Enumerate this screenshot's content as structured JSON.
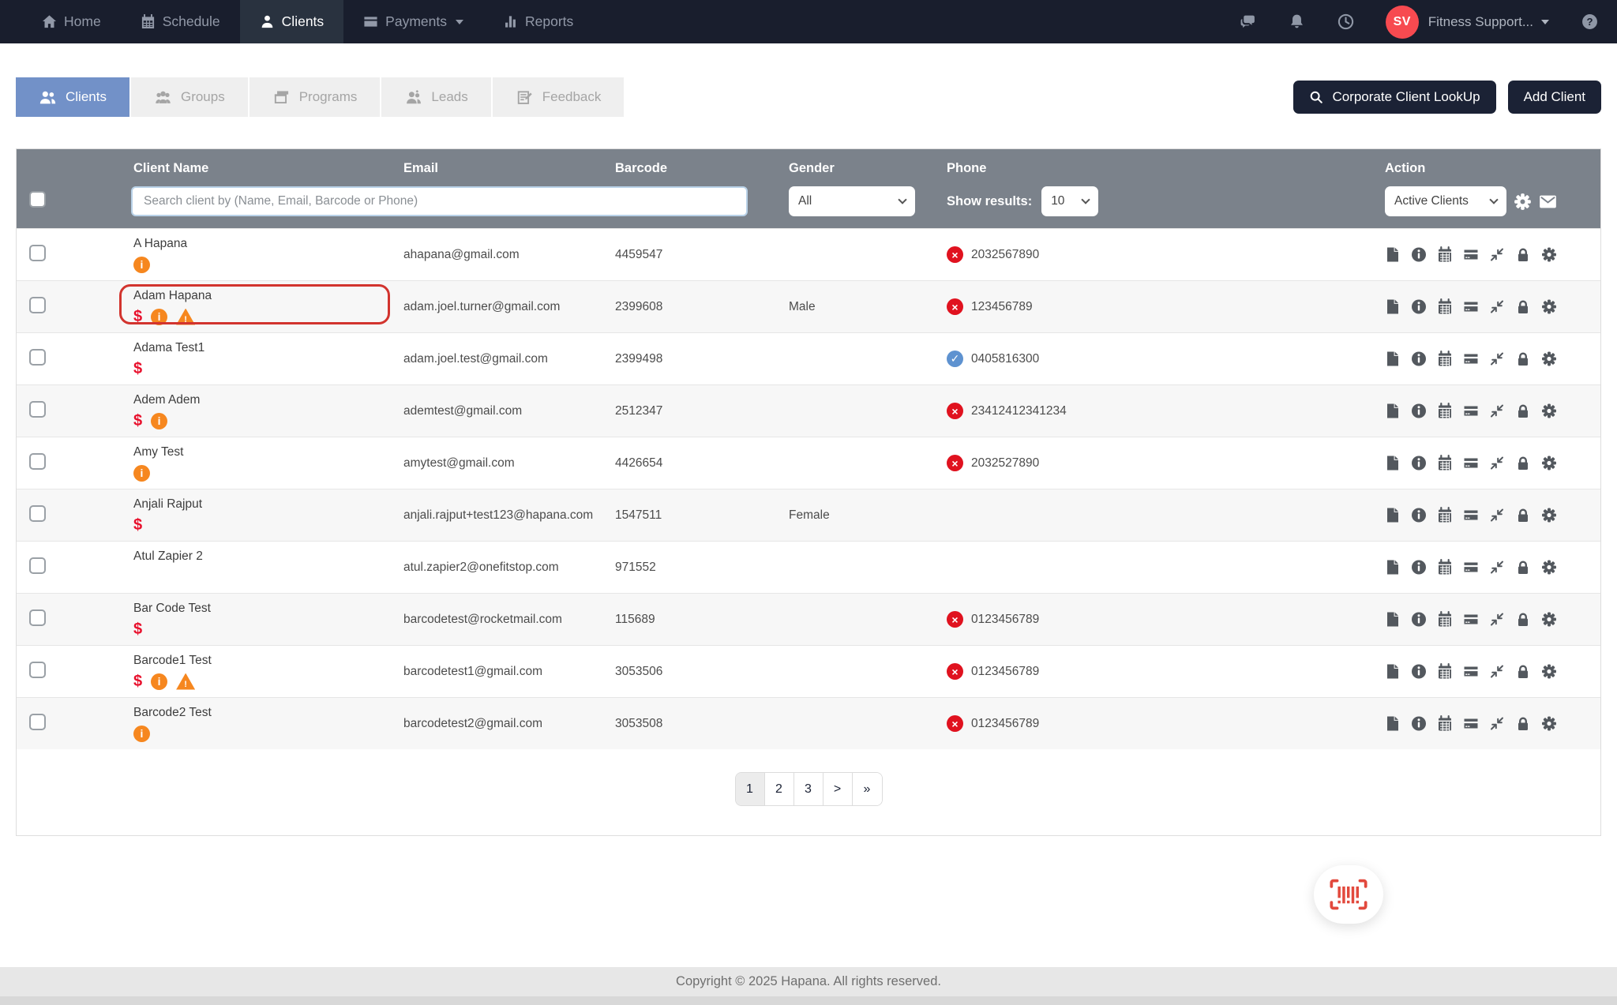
{
  "nav": {
    "items": [
      {
        "label": "Home"
      },
      {
        "label": "Schedule"
      },
      {
        "label": "Clients",
        "active": true
      },
      {
        "label": "Payments",
        "caret": true
      },
      {
        "label": "Reports"
      }
    ],
    "right": {
      "avatar_initials": "SV",
      "account_name": "Fitness Support..."
    }
  },
  "tabs": [
    {
      "label": "Clients",
      "active": true
    },
    {
      "label": "Groups"
    },
    {
      "label": "Programs"
    },
    {
      "label": "Leads"
    },
    {
      "label": "Feedback"
    }
  ],
  "toolbar": {
    "corporate_lookup": "Corporate Client LookUp",
    "add_client": "Add Client"
  },
  "table": {
    "columns": {
      "name": "Client Name",
      "email": "Email",
      "barcode": "Barcode",
      "gender": "Gender",
      "phone": "Phone",
      "action": "Action"
    },
    "filters": {
      "search_placeholder": "Search client by (Name, Email, Barcode or Phone)",
      "gender": "All",
      "show_results_label": "Show results:",
      "show_results": "10",
      "view": "Active Clients"
    },
    "row_actions": [
      "notes-icon",
      "info-circle-icon",
      "calendar-icon",
      "payment-card-icon",
      "compress-icon",
      "lock-icon",
      "settings-icon"
    ],
    "rows": [
      {
        "name": "A Hapana",
        "badges": [
          "info"
        ],
        "email": "ahapana@gmail.com",
        "barcode": "4459547",
        "gender": "",
        "phone": {
          "status": "invalid",
          "number": "2032567890"
        }
      },
      {
        "name": "Adam Hapana",
        "badges": [
          "dollar",
          "info",
          "warning"
        ],
        "email": "adam.joel.turner@gmail.com",
        "barcode": "2399608",
        "gender": "Male",
        "phone": {
          "status": "invalid",
          "number": "123456789"
        },
        "highlighted": true
      },
      {
        "name": "Adama Test1",
        "badges": [
          "dollar"
        ],
        "email": "adam.joel.test@gmail.com",
        "barcode": "2399498",
        "gender": "",
        "phone": {
          "status": "valid",
          "number": "0405816300"
        }
      },
      {
        "name": "Adem Adem",
        "badges": [
          "dollar",
          "info"
        ],
        "email": "ademtest@gmail.com",
        "barcode": "2512347",
        "gender": "",
        "phone": {
          "status": "invalid",
          "number": "23412412341234"
        }
      },
      {
        "name": "Amy Test",
        "badges": [
          "info"
        ],
        "email": "amytest@gmail.com",
        "barcode": "4426654",
        "gender": "",
        "phone": {
          "status": "invalid",
          "number": "2032527890"
        }
      },
      {
        "name": "Anjali Rajput",
        "badges": [
          "dollar"
        ],
        "email": "anjali.rajput+test123@hapana.com",
        "barcode": "1547511",
        "gender": "Female",
        "phone": null
      },
      {
        "name": "Atul Zapier 2",
        "badges": [],
        "email": "atul.zapier2@onefitstop.com",
        "barcode": "971552",
        "gender": "",
        "phone": null
      },
      {
        "name": "Bar Code Test",
        "badges": [
          "dollar"
        ],
        "email": "barcodetest@rocketmail.com",
        "barcode": "115689",
        "gender": "",
        "phone": {
          "status": "invalid",
          "number": "0123456789"
        }
      },
      {
        "name": "Barcode1 Test",
        "badges": [
          "dollar",
          "info",
          "warning"
        ],
        "email": "barcodetest1@gmail.com",
        "barcode": "3053506",
        "gender": "",
        "phone": {
          "status": "invalid",
          "number": "0123456789"
        }
      },
      {
        "name": "Barcode2 Test",
        "badges": [
          "info"
        ],
        "email": "barcodetest2@gmail.com",
        "barcode": "3053508",
        "gender": "",
        "phone": {
          "status": "invalid",
          "number": "0123456789"
        }
      }
    ]
  },
  "pagination": {
    "pages": [
      "1",
      "2",
      "3",
      ">",
      "»"
    ],
    "active_index": 0
  },
  "footer": {
    "copyright": "Copyright © 2025 Hapana. All rights reserved."
  },
  "colors": {
    "nav_bg": "#191e2d",
    "active_tab": "#7291c8",
    "header_gray": "#7b828b",
    "avatar_red": "#f74a50",
    "alert_red": "#e8112d",
    "alert_orange": "#f6871f",
    "phone_invalid": "#e0121f",
    "phone_valid": "#5e92d0",
    "highlight_border": "#d2342e",
    "fab_icon": "#e2493d"
  }
}
